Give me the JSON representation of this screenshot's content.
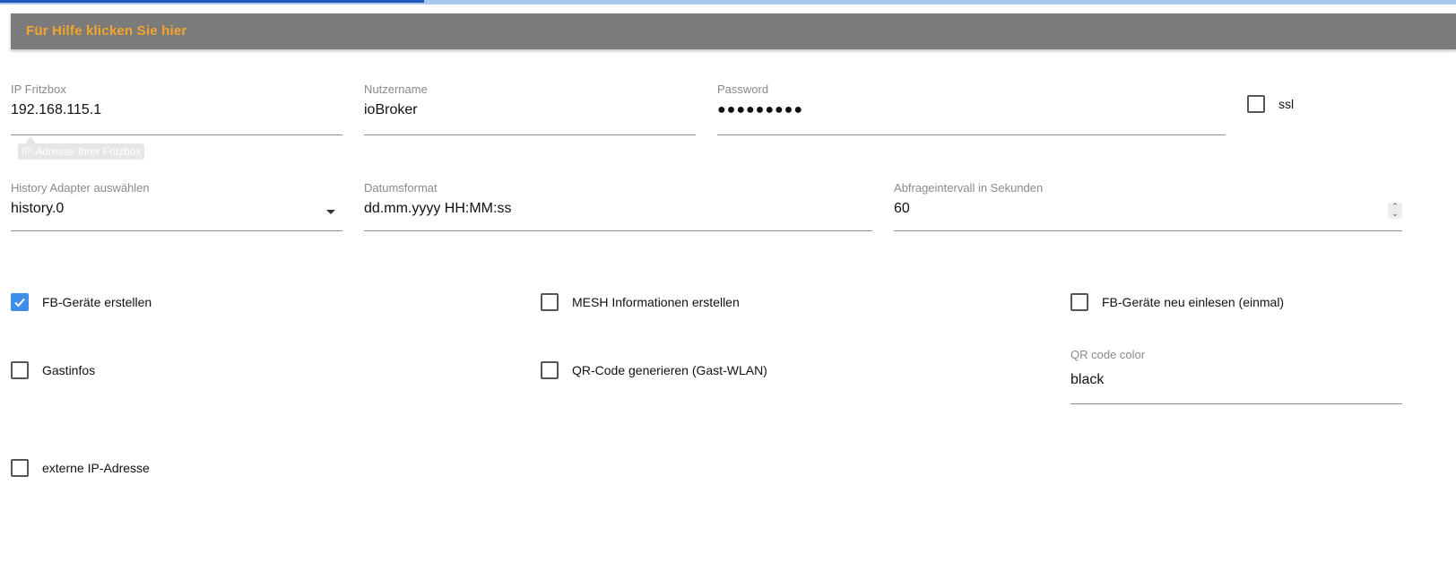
{
  "help_bar": {
    "text": "Für Hilfe klicken Sie hier"
  },
  "fields": {
    "ip": {
      "label": "IP Fritzbox",
      "value": "192.168.115.1",
      "tooltip": "IP-Adresse Ihrer Fritzbox"
    },
    "username": {
      "label": "Nutzername",
      "value": "ioBroker"
    },
    "password": {
      "label": "Password",
      "value": "●●●●●●●●●"
    },
    "history": {
      "label": "History Adapter auswählen",
      "value": "history.0"
    },
    "dateformat": {
      "label": "Datumsformat",
      "value": "dd.mm.yyyy HH:MM:ss"
    },
    "interval": {
      "label": "Abfrageintervall in Sekunden",
      "value": "60"
    },
    "qr_color": {
      "label": "QR code color",
      "value": "black"
    }
  },
  "checkboxes": {
    "ssl": {
      "label": "ssl",
      "checked": false
    },
    "fb_devices": {
      "label": "FB-Geräte erstellen",
      "checked": true
    },
    "mesh": {
      "label": "MESH Informationen erstellen",
      "checked": false
    },
    "fb_reread": {
      "label": "FB-Geräte neu einlesen (einmal)",
      "checked": false
    },
    "guest_info": {
      "label": "Gastinfos",
      "checked": false
    },
    "qr_code": {
      "label": "QR-Code generieren (Gast-WLAN)",
      "checked": false
    },
    "external_ip": {
      "label": "externe IP-Adresse",
      "checked": false
    }
  },
  "colors": {
    "help_bar_bg": "#7b7b7b",
    "help_text": "#f5a52a",
    "checkbox_checked": "#3f8fe8",
    "progress": "#1f57b8"
  },
  "icons": {
    "select": "chevron-down-icon",
    "check": "check-icon",
    "stepper": "number-stepper-icon"
  }
}
